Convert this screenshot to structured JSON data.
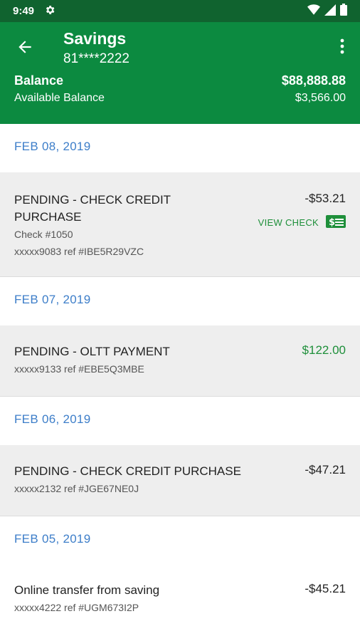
{
  "status_bar": {
    "time": "9:49"
  },
  "header": {
    "title": "Savings",
    "account_number": "81****2222",
    "balance_label": "Balance",
    "balance_value": "$88,888.88",
    "available_label": "Available Balance",
    "available_value": "$3,566.00"
  },
  "groups": [
    {
      "date": "FEB 08, 2019",
      "transactions": [
        {
          "description_line1": "PENDING - CHECK CREDIT",
          "description_line2": "PURCHASE",
          "check": "Check #1050",
          "ref": "xxxxx9083 ref #IBE5R29VZC",
          "amount": "-$53.21",
          "view_check_label": "VIEW CHECK"
        }
      ]
    },
    {
      "date": "FEB 07, 2019",
      "transactions": [
        {
          "description": "PENDING - OLTT PAYMENT",
          "ref": "xxxxx9133 ref #EBE5Q3MBE",
          "amount": "$122.00"
        }
      ]
    },
    {
      "date": "FEB 06, 2019",
      "transactions": [
        {
          "description": "PENDING - CHECK CREDIT PURCHASE",
          "ref": "xxxxx2132 ref #JGE67NE0J",
          "amount": "-$47.21"
        }
      ]
    },
    {
      "date": "FEB 05, 2019",
      "transactions": [
        {
          "description": "Online transfer from saving",
          "ref": "xxxxx4222 ref #UGM673I2P",
          "amount": "-$45.21"
        }
      ]
    }
  ],
  "colors": {
    "status_bar": "#10632f",
    "app_bar": "#0c8a40",
    "date_text": "#3d7ec9",
    "positive_amount": "#1e8f3a",
    "row_background": "#eeeeee"
  },
  "icons": [
    "settings-icon",
    "wifi-icon",
    "signal-icon",
    "battery-icon",
    "back-arrow-icon",
    "more-vert-icon",
    "check-image-icon"
  ]
}
